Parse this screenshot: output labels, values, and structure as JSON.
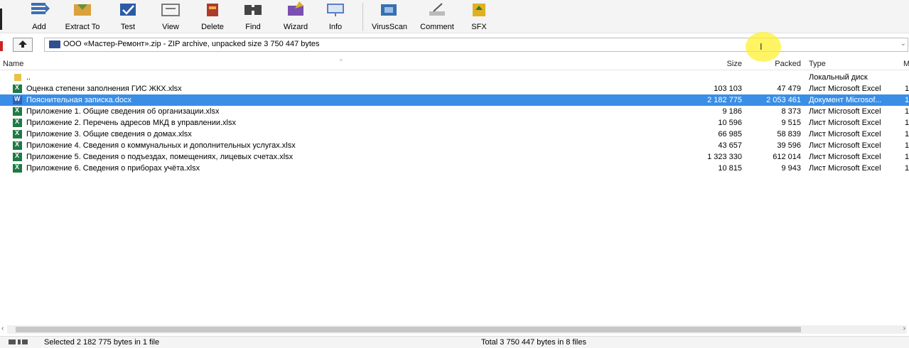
{
  "toolbar": {
    "buttons": [
      {
        "label": "Add",
        "icon": "add-icon",
        "color": "#3c6fb5"
      },
      {
        "label": "Extract To",
        "icon": "extract-to-icon",
        "color": "#d9a23c"
      },
      {
        "label": "Test",
        "icon": "test-icon",
        "color": "#2c5aa8"
      },
      {
        "label": "View",
        "icon": "view-icon",
        "color": "#7a7a7a"
      },
      {
        "label": "Delete",
        "icon": "delete-icon",
        "color": "#b03a2a"
      },
      {
        "label": "Find",
        "icon": "find-icon",
        "color": "#444444"
      },
      {
        "label": "Wizard",
        "icon": "wizard-icon",
        "color": "#7a4fb0"
      },
      {
        "label": "Info",
        "icon": "info-icon",
        "color": "#5b7fc4"
      },
      {
        "label": "VirusScan",
        "icon": "virusscan-icon",
        "color": "#3a6fb0"
      },
      {
        "label": "Comment",
        "icon": "comment-icon",
        "color": "#777777"
      },
      {
        "label": "SFX",
        "icon": "sfx-icon",
        "color": "#e0b020"
      }
    ]
  },
  "address": {
    "path": "ООО «Мастер-Ремонт».zip - ZIP archive, unpacked size 3 750 447 bytes"
  },
  "columns": {
    "name": "Name",
    "size": "Size",
    "packed": "Packed",
    "type": "Type",
    "modified": "M"
  },
  "files": [
    {
      "name": "..",
      "size": "",
      "packed": "",
      "type": "Локальный диск",
      "modified": "",
      "kind": "folder",
      "selected": false
    },
    {
      "name": "Оценка степени заполнения ГИС ЖКХ.xlsx",
      "size": "103 103",
      "packed": "47 479",
      "type": "Лист Microsoft Excel",
      "modified": "1",
      "kind": "excel",
      "selected": false
    },
    {
      "name": "Пояснительная записка.docx",
      "size": "2 182 775",
      "packed": "2 053 461",
      "type": "Документ Microsof...",
      "modified": "1",
      "kind": "word",
      "selected": true
    },
    {
      "name": "Приложение 1. Общие сведения об организации.xlsx",
      "size": "9 186",
      "packed": "8 373",
      "type": "Лист Microsoft Excel",
      "modified": "1",
      "kind": "excel",
      "selected": false
    },
    {
      "name": "Приложение 2. Перечень адресов МКД в управлении.xlsx",
      "size": "10 596",
      "packed": "9 515",
      "type": "Лист Microsoft Excel",
      "modified": "1",
      "kind": "excel",
      "selected": false
    },
    {
      "name": "Приложение 3. Общие сведения о домах.xlsx",
      "size": "66 985",
      "packed": "58 839",
      "type": "Лист Microsoft Excel",
      "modified": "1",
      "kind": "excel",
      "selected": false
    },
    {
      "name": "Приложение 4. Сведения о коммунальных и дополнительных услугах.xlsx",
      "size": "43 657",
      "packed": "39 596",
      "type": "Лист Microsoft Excel",
      "modified": "1",
      "kind": "excel",
      "selected": false
    },
    {
      "name": "Приложение 5. Сведения о подъездах, помещениях, лицевых счетах.xlsx",
      "size": "1 323 330",
      "packed": "612 014",
      "type": "Лист Microsoft Excel",
      "modified": "1",
      "kind": "excel",
      "selected": false
    },
    {
      "name": "Приложение 6. Сведения о приборах учёта.xlsx",
      "size": "10 815",
      "packed": "9 943",
      "type": "Лист Microsoft Excel",
      "modified": "1",
      "kind": "excel",
      "selected": false
    }
  ],
  "status": {
    "left": "Selected 2 182 775 bytes in 1 file",
    "right": "Total 3 750 447 bytes in 8 files"
  },
  "colors": {
    "selection": "#3a8ee6",
    "excel": "#1f7a44",
    "word": "#2a63b8",
    "cursor_highlight": "#fff028"
  }
}
